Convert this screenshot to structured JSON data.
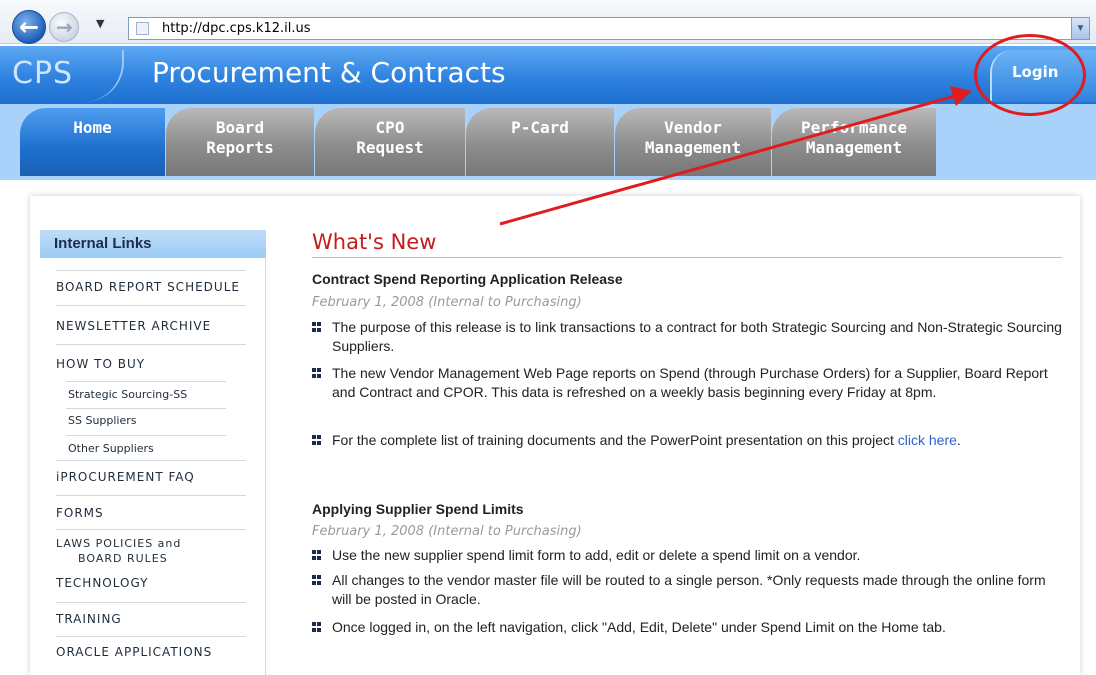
{
  "browser": {
    "url": "http://dpc.cps.k12.il.us",
    "back_glyph": "←",
    "forward_glyph": "→",
    "dropdown_glyph": "▼"
  },
  "header": {
    "logo": "CPS",
    "title": "Procurement & Contracts",
    "login_label": "Login"
  },
  "nav": {
    "tabs": [
      {
        "line1": "Home",
        "line2": "",
        "active": true
      },
      {
        "line1": "Board",
        "line2": "Reports",
        "active": false
      },
      {
        "line1": "CPO",
        "line2": "Request",
        "active": false
      },
      {
        "line1": "P-Card",
        "line2": "",
        "active": false
      },
      {
        "line1": "Vendor",
        "line2": "Management",
        "active": false
      },
      {
        "line1": "Performance",
        "line2": "Management",
        "active": false
      }
    ]
  },
  "sidebar": {
    "heading": "Internal Links",
    "items": [
      "BOARD REPORT SCHEDULE",
      "NEWSLETTER ARCHIVE",
      "HOW TO BUY",
      "iPROCUREMENT FAQ",
      "FORMS",
      "LAWS POLICIES and",
      "BOARD RULES",
      "TECHNOLOGY",
      "TRAINING",
      "ORACLE APPLICATIONS"
    ],
    "subitems": [
      "Strategic Sourcing-SS",
      "SS Suppliers",
      "Other Suppliers"
    ]
  },
  "main": {
    "heading": "What's New",
    "articles": [
      {
        "title": "Contract Spend Reporting Application Release",
        "date": "February 1, 2008 (Internal to Purchasing)",
        "bullets": [
          "The purpose of this release is to link transactions to a contract for both Strategic Sourcing and Non-Strategic Sourcing Suppliers.",
          "The new Vendor Management Web Page reports on Spend (through Purchase Orders) for a Supplier, Board Report and Contract and CPOR. This data is refreshed on a weekly basis beginning every Friday at 8pm.",
          "For the complete list of training documents and the PowerPoint presentation on this project"
        ],
        "link_text": "click here",
        "link_trail": "."
      },
      {
        "title": "Applying Supplier Spend Limits",
        "date": "February 1, 2008 (Internal to Purchasing)",
        "bullets": [
          "Use the new supplier spend limit form to add, edit or delete a spend limit on a vendor.",
          "All changes to the vendor master file will be routed to a single person. *Only requests made through the online form will be posted in Oracle.",
          "Once logged in, on the left navigation, click \"Add, Edit, Delete\" under Spend Limit on the Home tab."
        ]
      }
    ]
  },
  "colors": {
    "header_blue": "#2f82df",
    "nav_band": "#a9d2fb",
    "active_tab": "#1e6fcf",
    "inactive_tab": "#8d8d8d",
    "heading_red": "#c21c1c",
    "annotation_red": "#e01c1c",
    "link_blue": "#2a62c9"
  }
}
